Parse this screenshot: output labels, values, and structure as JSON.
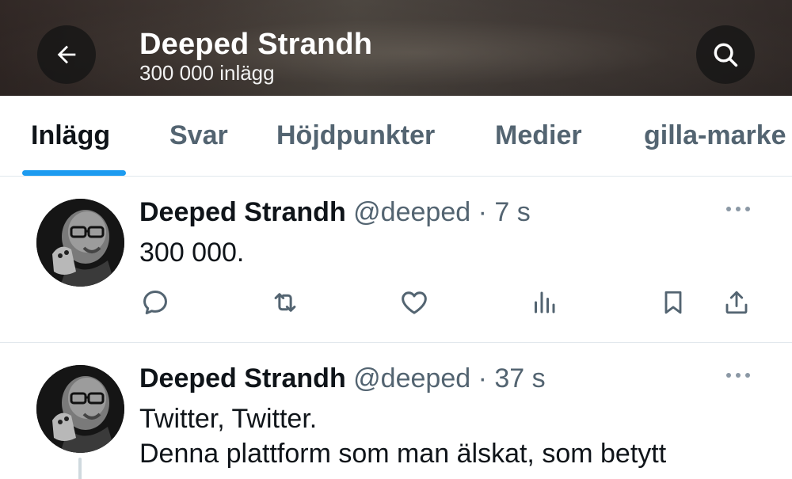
{
  "header": {
    "name": "Deeped Strandh",
    "post_count": "300 000 inlägg",
    "back_icon": "arrow-left-icon",
    "search_icon": "search-icon"
  },
  "tabs": [
    {
      "label": "Inlägg",
      "active": true
    },
    {
      "label": "Svar",
      "active": false
    },
    {
      "label": "Höjdpunkter",
      "active": false
    },
    {
      "label": "Medier",
      "active": false
    },
    {
      "label": "gilla-marke",
      "active": false
    }
  ],
  "colors": {
    "accent": "#1d9bf0",
    "text_primary": "#0f1419",
    "text_secondary": "#536471"
  },
  "tweets": [
    {
      "name": "Deeped Strandh",
      "handle": "@deeped",
      "dot": "·",
      "time": "7 s",
      "text_lines": [
        "300 000."
      ],
      "actions": [
        "reply-icon",
        "retweet-icon",
        "like-icon",
        "views-icon",
        "bookmark-icon",
        "share-icon"
      ]
    },
    {
      "name": "Deeped Strandh",
      "handle": "@deeped",
      "dot": "·",
      "time": "37 s",
      "text_lines": [
        "Twitter, Twitter.",
        "Denna plattform som man älskat, som betytt"
      ]
    }
  ]
}
